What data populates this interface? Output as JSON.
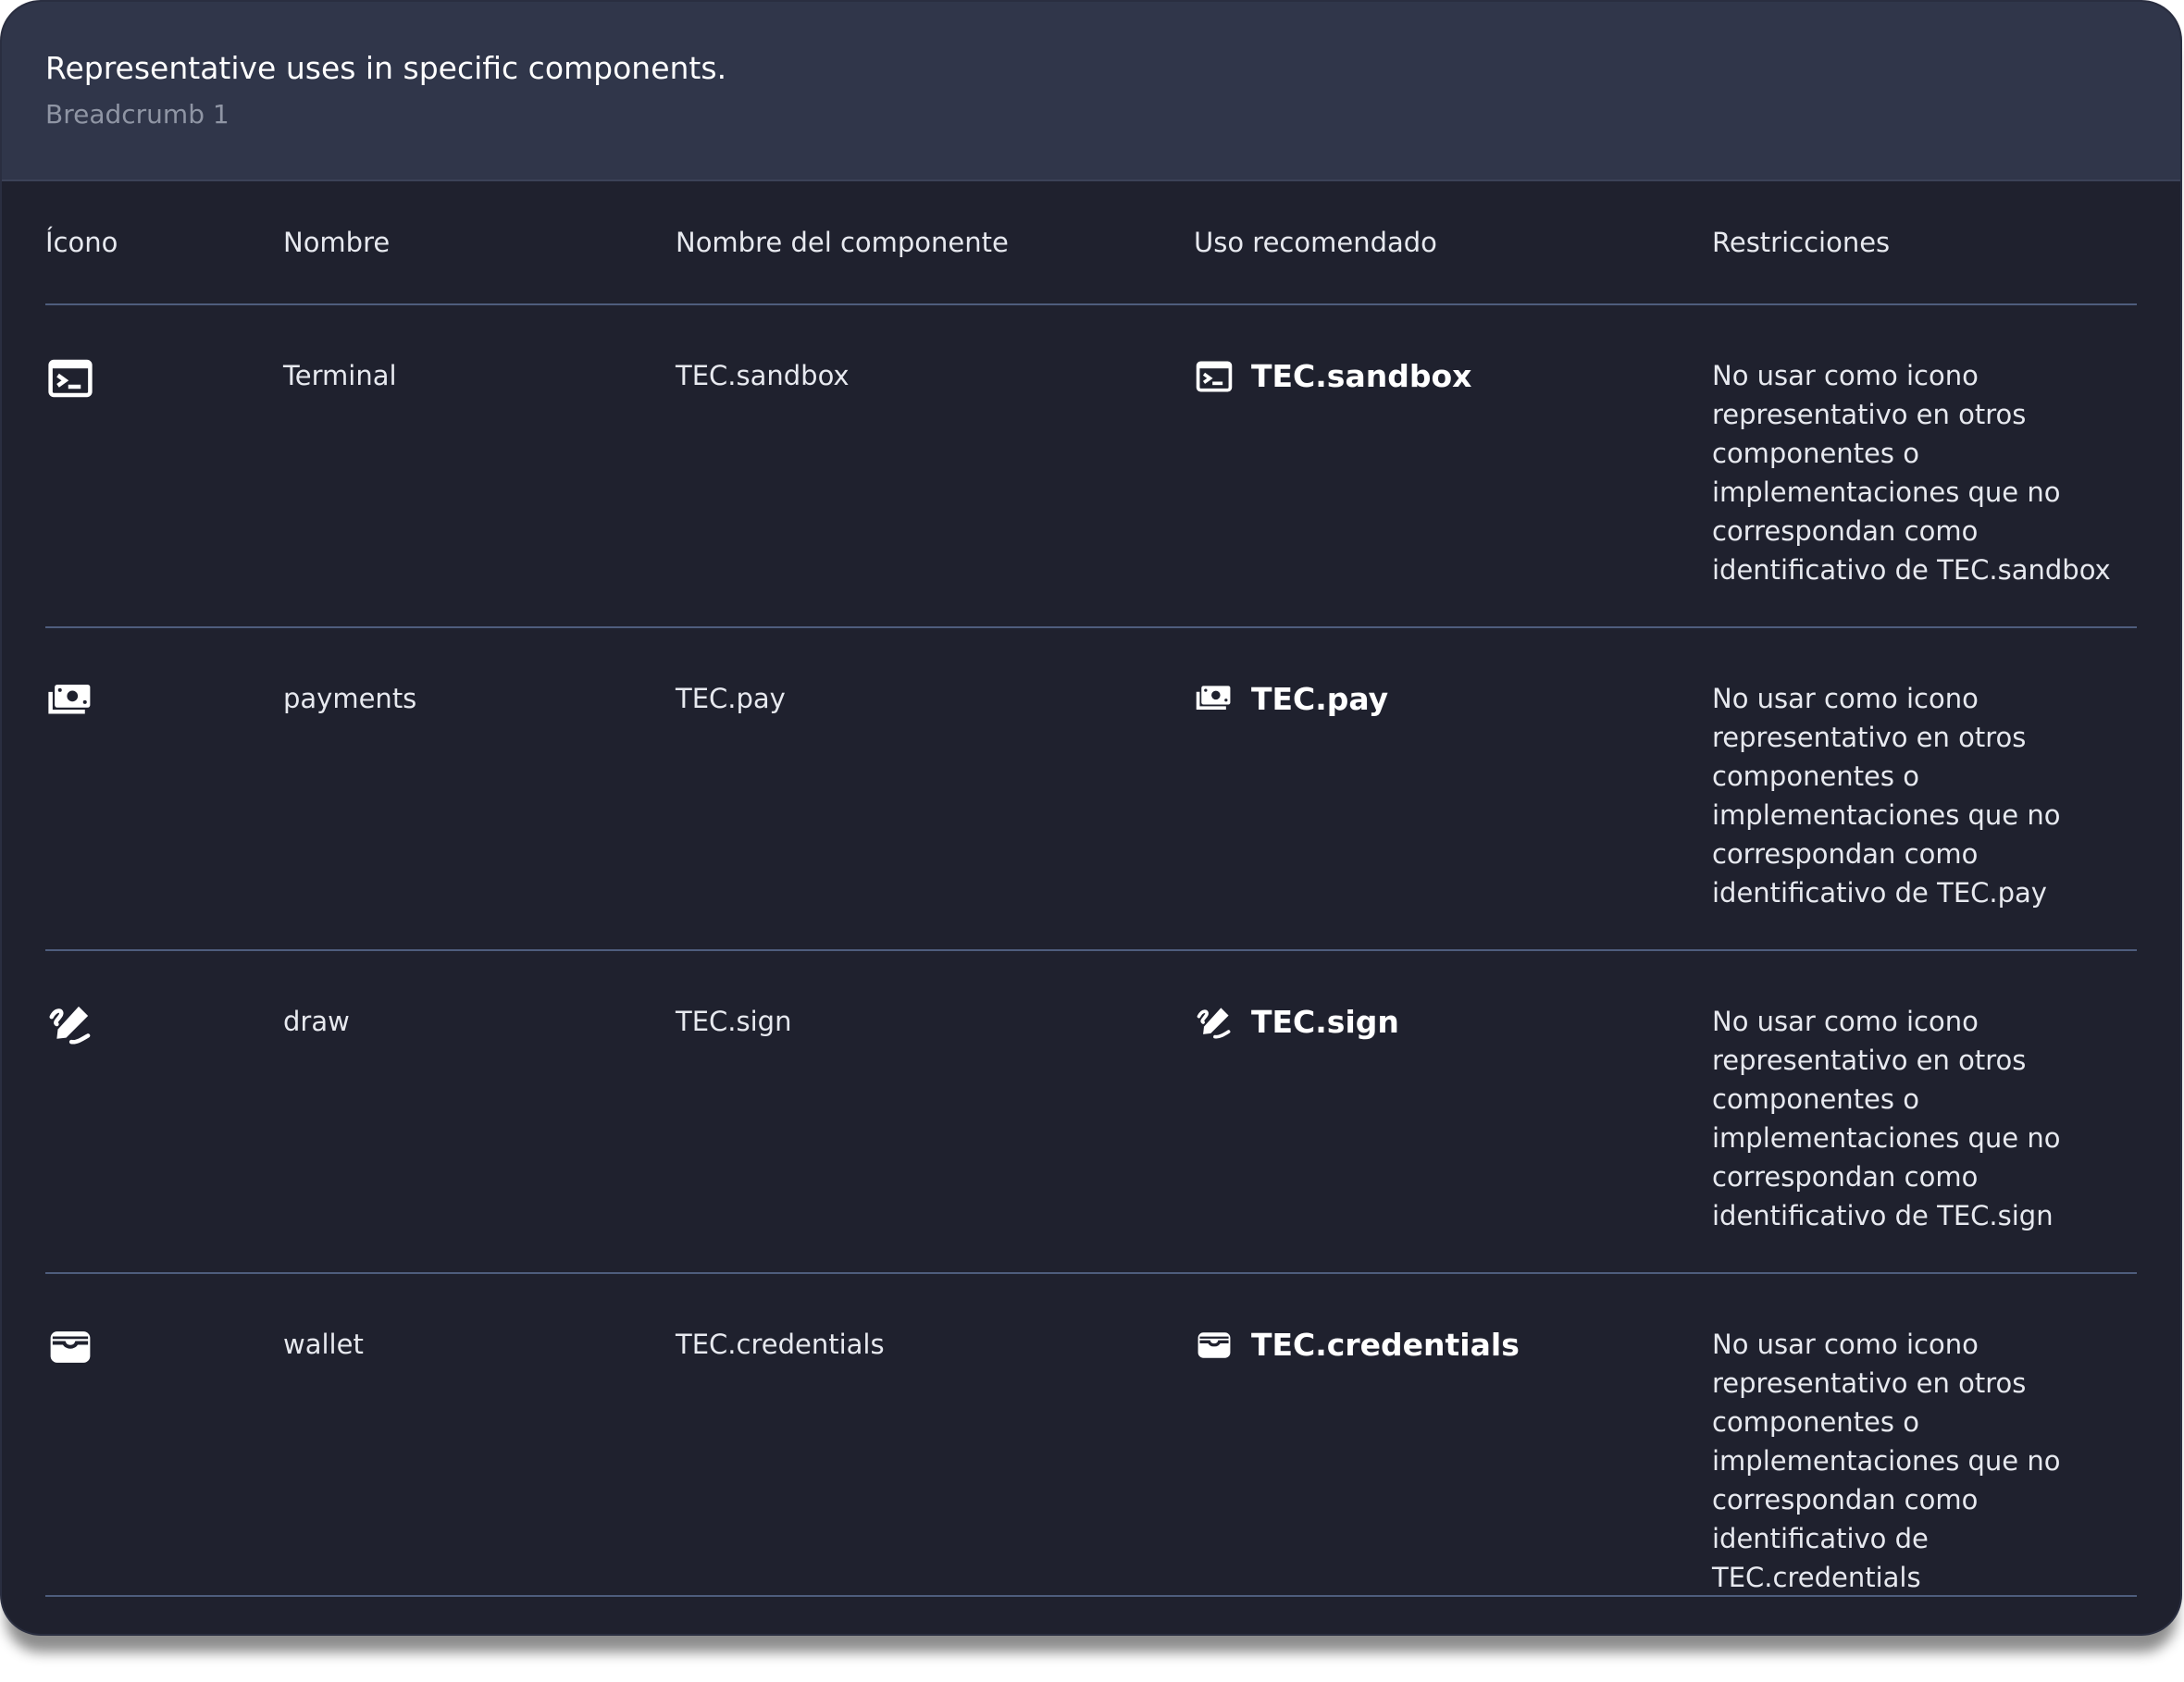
{
  "header": {
    "title": "Representative uses in specific components.",
    "breadcrumb": "Breadcrumb 1"
  },
  "table": {
    "columns": [
      "Ícono",
      "Nombre",
      "Nombre del componente",
      "Uso recomendado",
      "Restricciones"
    ],
    "rows": [
      {
        "icon": "terminal-icon",
        "name": "Terminal",
        "component": "TEC.sandbox",
        "use_label": "TEC.sandbox",
        "restriction": "No usar como icono representativo en otros componentes o implementaciones que no correspondan como identificativo de  TEC.sandbox"
      },
      {
        "icon": "payments-icon",
        "name": "payments",
        "component": "TEC.pay",
        "use_label": "TEC.pay",
        "restriction": "No usar como icono representativo en otros componentes o implementaciones que no correspondan como identificativo de  TEC.pay"
      },
      {
        "icon": "draw-icon",
        "name": "draw",
        "component": "TEC.sign",
        "use_label": "TEC.sign",
        "restriction": "No usar como icono representativo en otros componentes o implementaciones que no correspondan como identificativo de  TEC.sign"
      },
      {
        "icon": "wallet-icon",
        "name": "wallet",
        "component": "TEC.credentials",
        "use_label": "TEC.credentials",
        "restriction": "No usar como icono representativo en otros componentes o implementaciones que no correspondan como identificativo de  TEC.credentials"
      }
    ]
  },
  "colors": {
    "background": "#1f212e",
    "header": "#30364a",
    "divider": "#4e5d7d",
    "text": "#e7e9ef"
  }
}
